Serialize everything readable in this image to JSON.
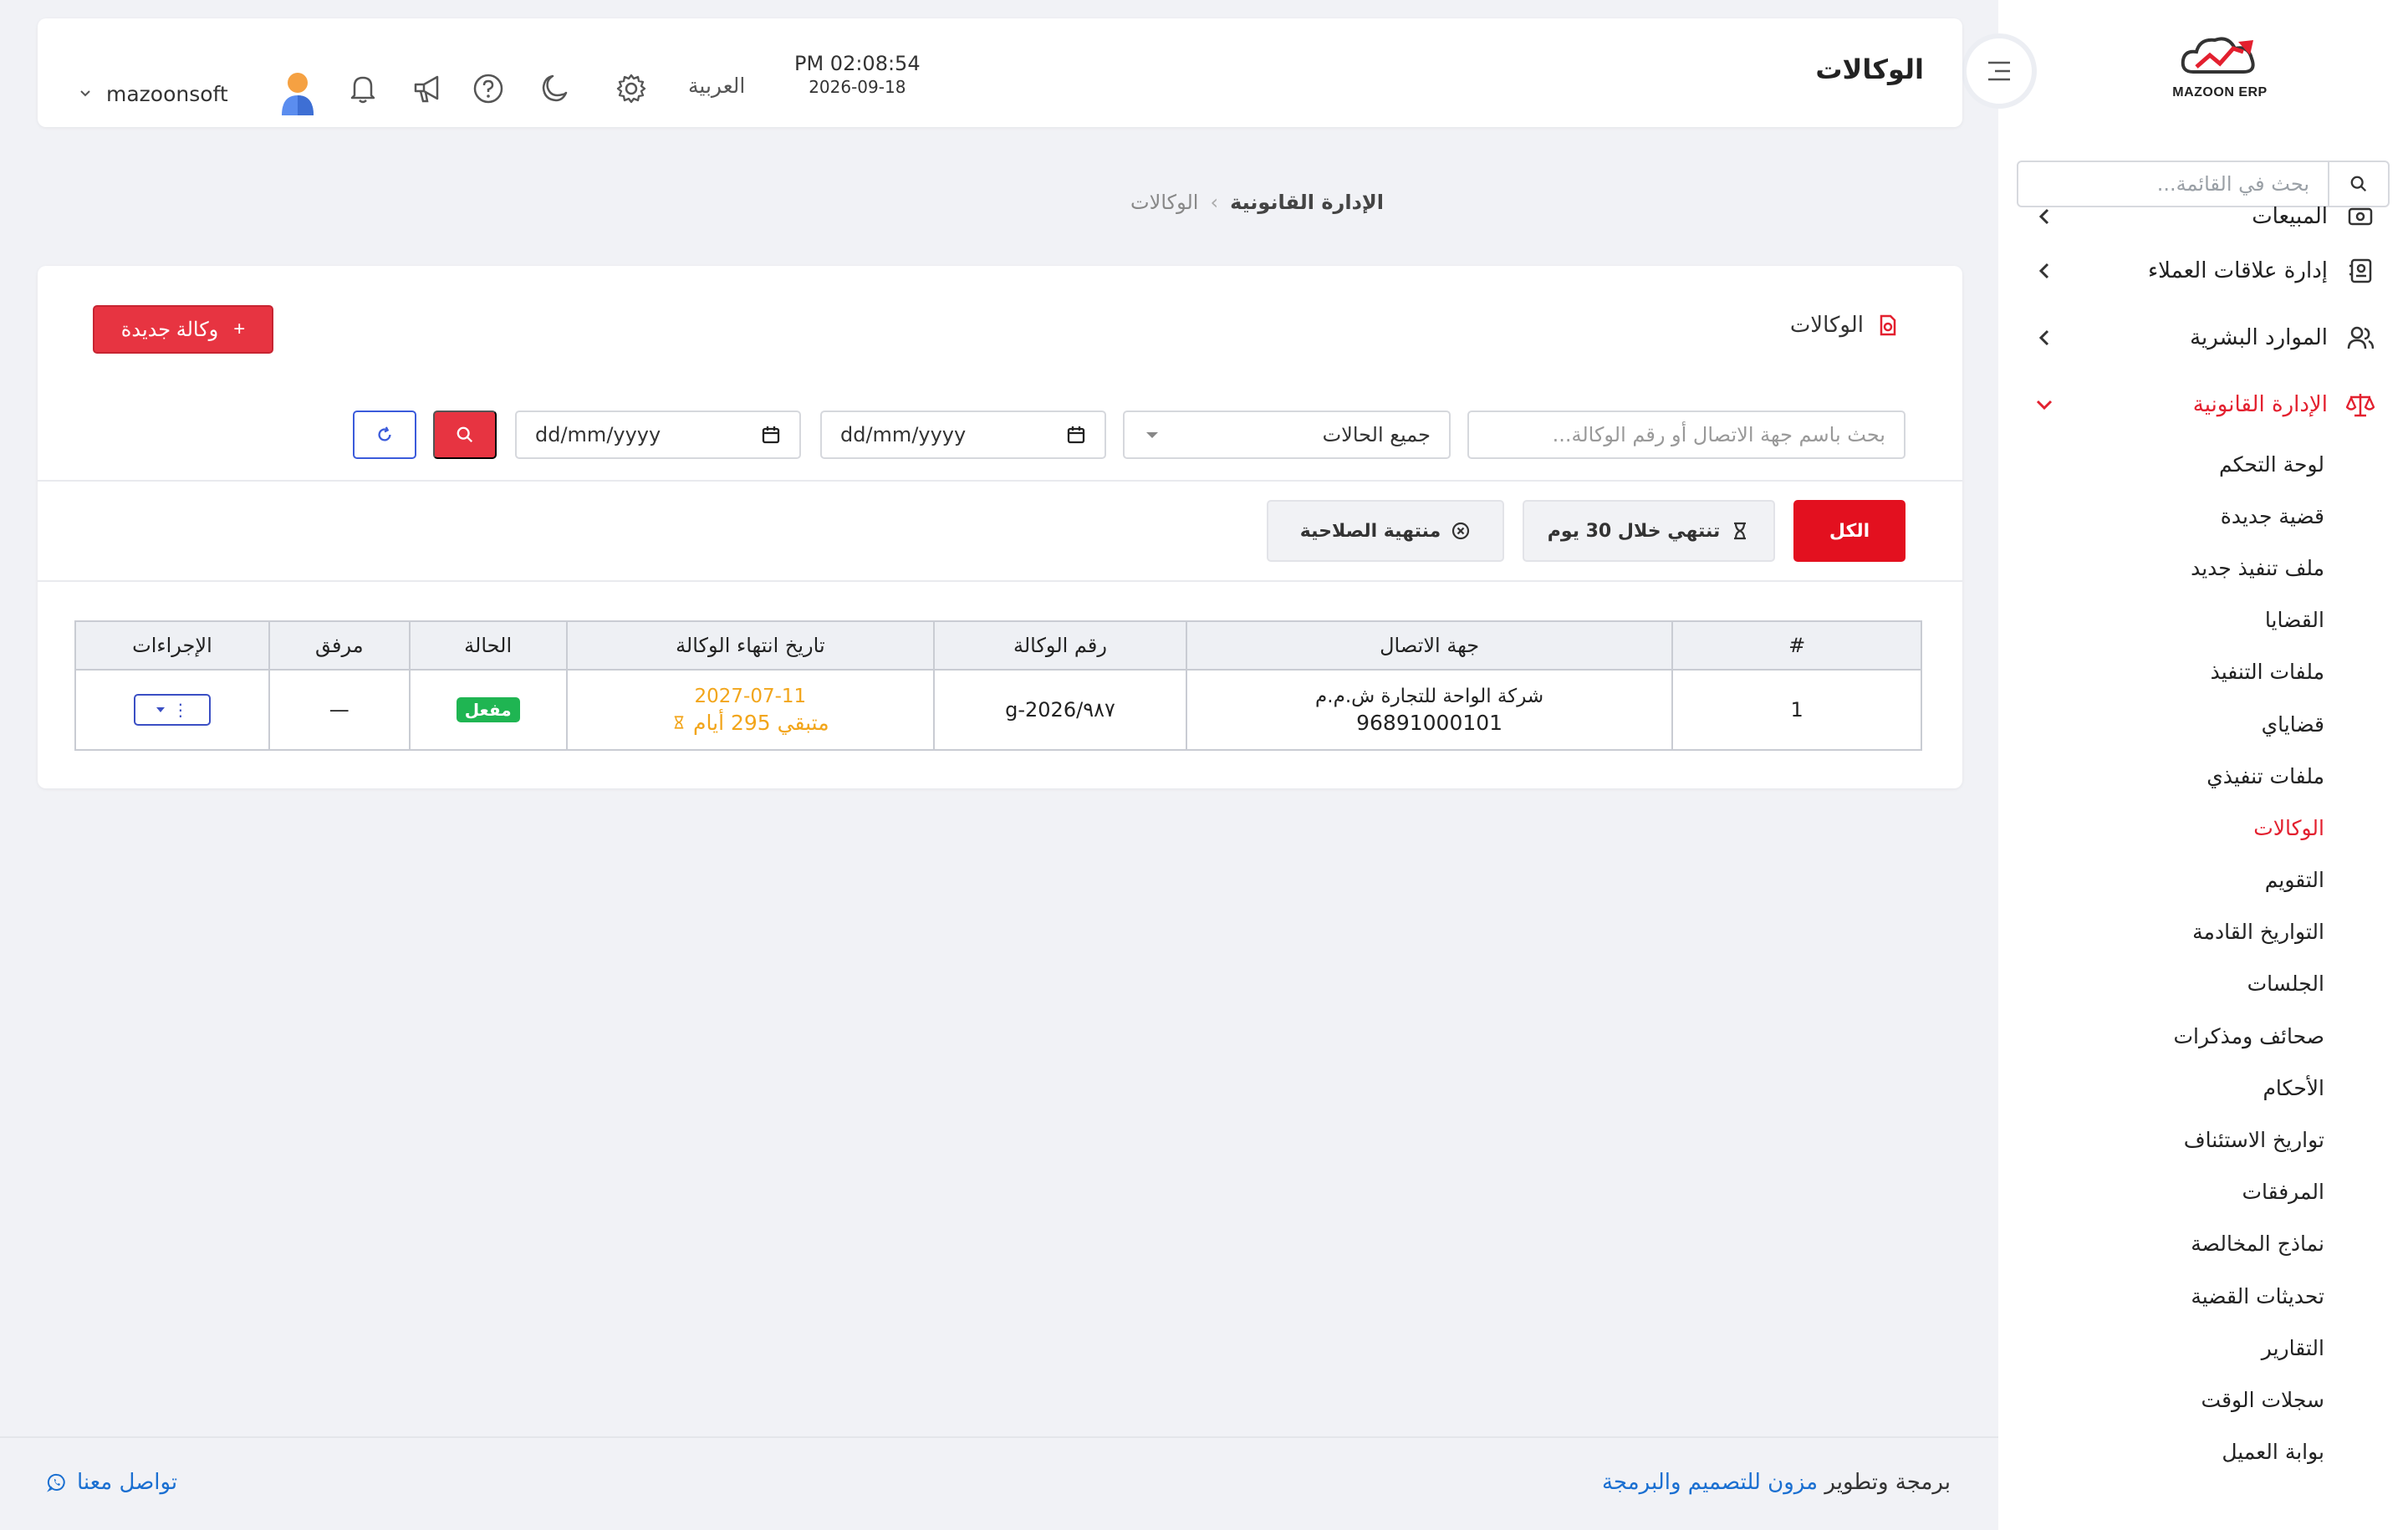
{
  "app": {
    "logo_text": "MAZOON ERP",
    "accent_color": "#e3202f"
  },
  "header": {
    "title": "الوكالات",
    "time": "PM 02:08:54",
    "date": "2026-09-18",
    "language": "العربية",
    "username": "mazoonsoft",
    "icons": [
      "settings-icon",
      "moon-icon",
      "help-icon",
      "megaphone-icon",
      "bell-icon"
    ]
  },
  "sidebar": {
    "search_placeholder": "بحث في القائمة...",
    "items": [
      {
        "label": "المبيعات",
        "icon": "sales-icon"
      },
      {
        "label": "إدارة علاقات العملاء",
        "icon": "contacts-icon"
      },
      {
        "label": "الموارد البشرية",
        "icon": "users-icon"
      },
      {
        "label": "الإدارة القانونية",
        "icon": "scales-icon",
        "active": true
      }
    ],
    "submenu": [
      "لوحة التحكم",
      "قضية جديدة",
      "ملف تنفيذ جديد",
      "القضايا",
      "ملفات التنفيذ",
      "قضاياي",
      "ملفات تنفيذي",
      "الوكالات",
      "التقويم",
      "التواريخ القادمة",
      "الجلسات",
      "صحائف ومذكرات",
      "الأحكام",
      "تواريخ الاستئناف",
      "المرفقات",
      "نماذج المخالصة",
      "تحديثات القضية",
      "التقارير",
      "سجلات الوقت",
      "بوابة العميل"
    ],
    "active_submenu": "الوكالات"
  },
  "breadcrumb": {
    "parent": "الإدارة القانونية",
    "current": "الوكالات"
  },
  "card": {
    "title": "الوكالات",
    "new_button": "وكالة جديدة",
    "new_button_plus": "+"
  },
  "filters": {
    "search_placeholder": "بحث باسم جهة الاتصال أو رقم الوكالة...",
    "status_value": "جميع الحالات",
    "date_from": "dd/mm/yyyy",
    "date_to": "dd/mm/yyyy"
  },
  "tabs": {
    "all": "الكل",
    "expiring_30": "تنتهي خلال 30 يوم",
    "expired": "منتهية الصلاحية"
  },
  "table": {
    "columns": [
      "#",
      "جهة الاتصال",
      "رقم الوكالة",
      "تاريخ انتهاء الوكالة",
      "الحالة",
      "مرفق",
      "الإجراءات"
    ],
    "rows": [
      {
        "index": "1",
        "contact_name": "شركة الواحة للتجارة ش.م.م",
        "contact_phone": "96891000101",
        "agency_number": "٩٨٧/2026-g",
        "expiry_date": "2027-07-11",
        "remaining": "متبقي 295 أيام",
        "status": "مفعل",
        "status_color": "#1fb552",
        "attachment": "—",
        "actions_label": "⋮"
      }
    ]
  },
  "footer": {
    "credit_prefix": "برمجة وتطوير",
    "credit_link": "مزون للتصميم والبرمجة",
    "contact": "تواصل معنا"
  }
}
